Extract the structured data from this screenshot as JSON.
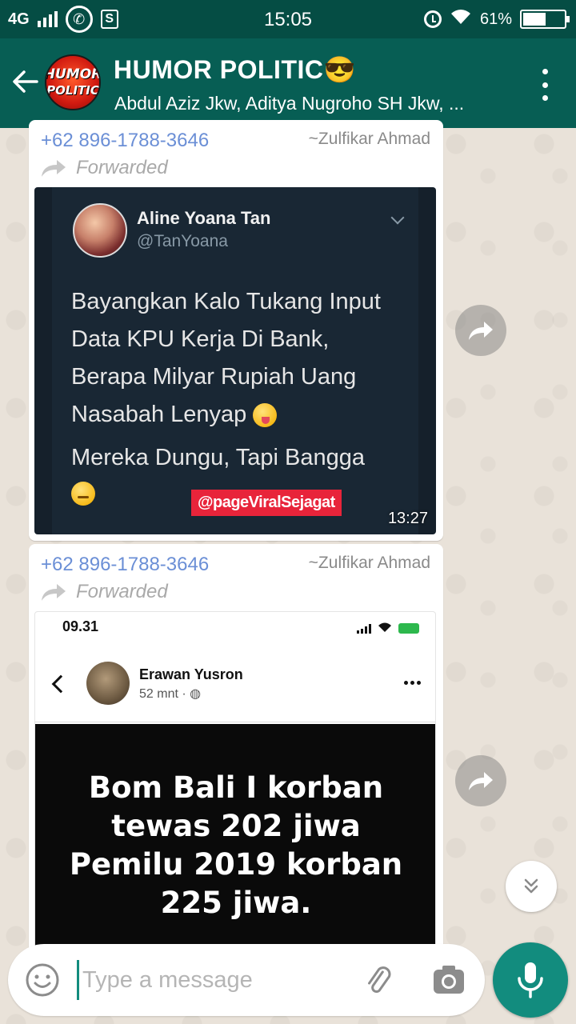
{
  "status_bar": {
    "network": "4G",
    "time": "15:05",
    "battery": "61%",
    "icons": [
      "signal-icon",
      "whatsapp-icon",
      "s-notification-icon",
      "alarm-icon",
      "wifi-icon",
      "battery-icon"
    ]
  },
  "header": {
    "avatar_text_line1": "HUMOR",
    "avatar_text_line2": "POLITIC",
    "title": "HUMOR POLITIC😎",
    "subtitle": "Abdul Aziz Jkw, Aditya Nugroho SH Jkw, ..."
  },
  "messages": [
    {
      "sender_phone": "+62 896-1788-3646",
      "sender_name": "~Zulfikar Ahmad",
      "forwarded_label": "Forwarded",
      "image": {
        "author_name": "Aline Yoana Tan",
        "author_handle": "@TanYoana",
        "tweet_text": "Bayangkan Kalo Tukang Input Data KPU Kerja Di Bank, Berapa Milyar Rupiah Uang Nasabah Lenyap",
        "tweet_text2": "Mereka Dungu, Tapi Bangga",
        "watermark": "@pageViralSejagat"
      },
      "time": "13:27"
    },
    {
      "sender_phone": "+62 896-1788-3646",
      "sender_name": "~Zulfikar Ahmad",
      "forwarded_label": "Forwarded",
      "image": {
        "phone_time": "09.31",
        "author_name": "Erawan Yusron",
        "post_meta": "52 mnt ·",
        "post_text_line1": "Bom Bali I korban",
        "post_text_line2": "tewas 202 jiwa",
        "post_text_line3": "Pemilu 2019 korban",
        "post_text_line4": "225 jiwa."
      }
    }
  ],
  "composer": {
    "placeholder": "Type a message",
    "value": ""
  },
  "colors": {
    "header": "#075e54",
    "status_bar": "#054d44",
    "accent": "#128c7e",
    "sender_phone": "#6b8fd6"
  }
}
